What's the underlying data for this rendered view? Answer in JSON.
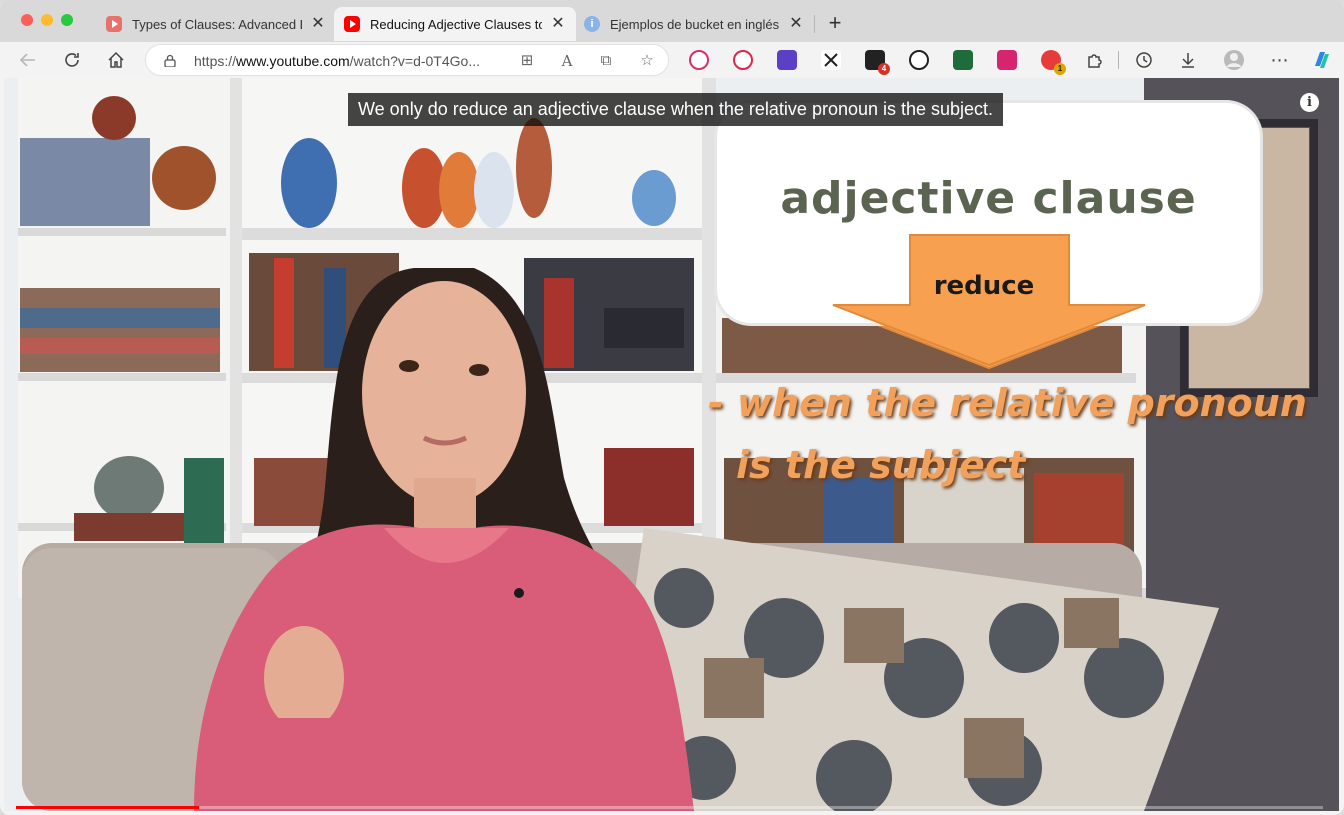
{
  "window": {
    "tabs": [
      {
        "title": "Types of Clauses: Advanced En",
        "active": false,
        "favicon": "youtube-icon"
      },
      {
        "title": "Reducing Adjective Clauses to",
        "active": true,
        "favicon": "youtube-icon"
      },
      {
        "title": "Ejemplos de bucket en inglés |",
        "active": false,
        "favicon": "info-icon"
      }
    ],
    "new_tab_label": "+"
  },
  "toolbar": {
    "url_prefix": "https://",
    "url_host": "www.youtube.com",
    "url_path": "/watch?v=d-0T4Go...",
    "extension_badges": {
      "extension_4": "4",
      "extension_9": "1"
    }
  },
  "video": {
    "caption": "We only do reduce an adjective clause when the relative pronoun is the subject.",
    "info_label": "i",
    "board_title": "adjective clause",
    "arrow_label": "reduce",
    "rule_line_1": "- when the relative pronoun",
    "rule_line_2": "is the subject",
    "progress_fraction": 0.14,
    "colors": {
      "arrow": "#f7a04f",
      "rule_text": "#f1a15b",
      "board_text": "#5b6351",
      "sweater": "#d95d78",
      "progress": "#ff0000"
    }
  }
}
